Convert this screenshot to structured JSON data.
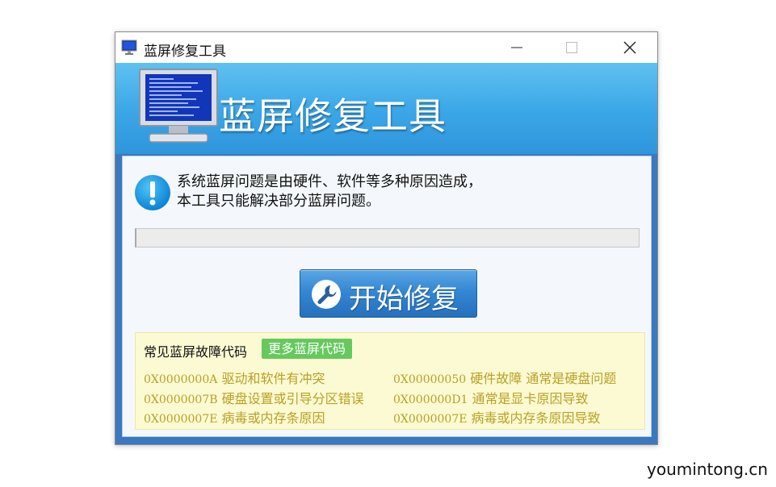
{
  "window": {
    "title": "蓝屏修复工具"
  },
  "header": {
    "title": "蓝屏修复工具"
  },
  "message": {
    "line1": "系统蓝屏问题是由硬件、软件等多种原因造成，",
    "line2": "本工具只能解决部分蓝屏问题。"
  },
  "progress": {
    "value": 0
  },
  "start_button": {
    "label": "开始修复"
  },
  "codes": {
    "title": "常见蓝屏故障代码",
    "more_label": "更多蓝屏代码",
    "left": [
      {
        "code": "0X0000000A",
        "desc": "驱动和软件有冲突"
      },
      {
        "code": "0X0000007B",
        "desc": "硬盘设置或引导分区错误"
      },
      {
        "code": "0X0000007E",
        "desc": "病毒或内存条原因"
      }
    ],
    "right": [
      {
        "code": "0X00000050",
        "desc": "硬件故障 通常是硬盘问题"
      },
      {
        "code": "0X000000D1",
        "desc": "通常是显卡原因导致"
      },
      {
        "code": "0X0000007E",
        "desc": "病毒或内存条原因导致"
      }
    ]
  },
  "watermark": "youmintong.cn",
  "colors": {
    "header": "#3aa6e7",
    "button": "#3587d3",
    "more_button": "#66c95e",
    "code_text": "#b8a128",
    "codes_bg": "#fbfad2"
  },
  "icons": [
    "monitor-icon",
    "minimize-icon",
    "maximize-icon",
    "close-icon",
    "info-icon",
    "wrench-icon"
  ]
}
